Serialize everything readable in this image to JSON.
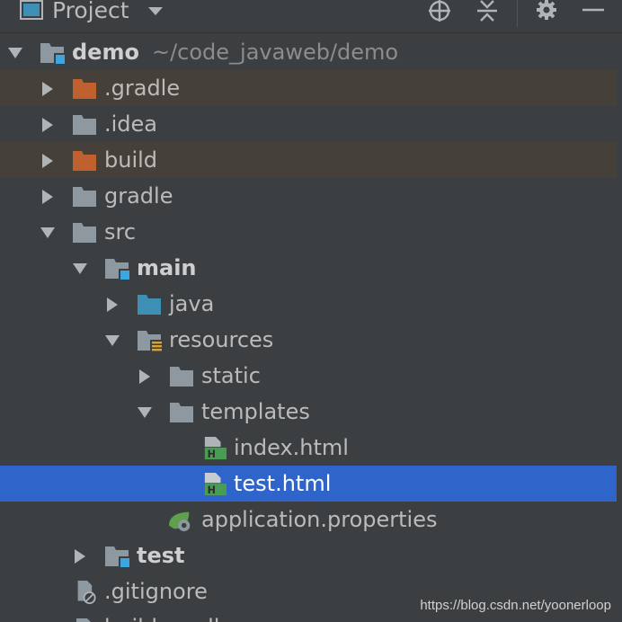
{
  "header": {
    "title": "Project",
    "icons": [
      "project-panel-icon",
      "dropdown-caret-icon",
      "locate-icon",
      "collapse-icon",
      "gear-icon",
      "minimize-icon"
    ]
  },
  "tree": [
    {
      "label": "demo",
      "path": "~/code_javaweb/demo",
      "expanded": true,
      "icon": "module-folder-icon"
    },
    {
      "label": ".gradle",
      "expanded": false,
      "icon": "excluded-folder-icon",
      "excluded": true
    },
    {
      "label": ".idea",
      "expanded": false,
      "icon": "folder-icon"
    },
    {
      "label": "build",
      "expanded": false,
      "icon": "excluded-folder-icon",
      "excluded": true
    },
    {
      "label": "gradle",
      "expanded": false,
      "icon": "folder-icon"
    },
    {
      "label": "src",
      "expanded": true,
      "icon": "folder-icon"
    },
    {
      "label": "main",
      "expanded": true,
      "icon": "module-folder-icon"
    },
    {
      "label": "java",
      "expanded": false,
      "icon": "source-folder-icon"
    },
    {
      "label": "resources",
      "expanded": true,
      "icon": "resources-folder-icon"
    },
    {
      "label": "static",
      "expanded": false,
      "icon": "folder-icon"
    },
    {
      "label": "templates",
      "expanded": true,
      "icon": "folder-icon"
    },
    {
      "label": "index.html",
      "icon": "html-file-icon"
    },
    {
      "label": "test.html",
      "icon": "html-file-icon",
      "selected": true
    },
    {
      "label": "application.properties",
      "icon": "spring-properties-icon"
    },
    {
      "label": "test",
      "expanded": false,
      "icon": "module-folder-icon"
    },
    {
      "label": ".gitignore",
      "icon": "ignored-file-icon"
    },
    {
      "label": "build.gradle",
      "icon": "gradle-file-icon"
    }
  ],
  "watermark": "https://blog.csdn.net/yoonerloop",
  "colors": {
    "background": "#3c3f41",
    "selection": "#2f65ca",
    "excluded_row": "#45413a",
    "excluded_folder": "#c0602f",
    "folder": "#8d98a1",
    "source_folder": "#3d8fb5",
    "module_badge": "#3da6e0"
  }
}
